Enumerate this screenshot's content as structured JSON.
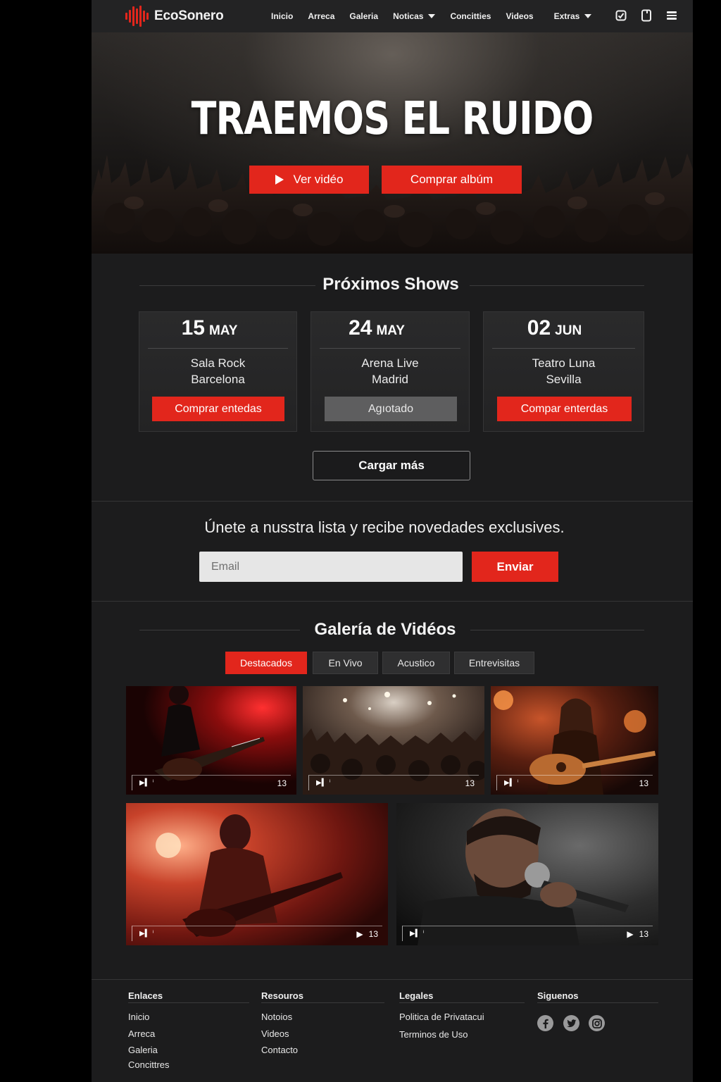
{
  "brand": {
    "name": "EcoSonero",
    "accent": "#e2261c"
  },
  "nav": {
    "items": [
      "Inicio",
      "Arreca",
      "Galeria",
      "Noticas",
      "Concitties",
      "Videos",
      "Extras"
    ],
    "dropdowns": [
      "Noticas",
      "Extras"
    ],
    "icons": [
      "checkbox-icon",
      "tablet-icon",
      "menu-icon"
    ]
  },
  "hero": {
    "title": "TRAEMOS EL RUIDO",
    "video_button": "Ver vidéo",
    "album_button": "Comprar albúm"
  },
  "shows": {
    "title": "Próximos Shows",
    "items": [
      {
        "day": "15",
        "month": "MAY",
        "venue": "Sala Rock",
        "city": "Barcelona",
        "button": "Comprar entedas",
        "status": "available"
      },
      {
        "day": "24",
        "month": "MAY",
        "venue": "Arena Live",
        "city": "Madrid",
        "button": "Agıotado",
        "status": "sold-out"
      },
      {
        "day": "02",
        "month": "JUN",
        "venue": "Teatro Luna",
        "city": "Sevilla",
        "button": "Compar enterdas",
        "status": "available"
      }
    ],
    "load_more": "Cargar más"
  },
  "newsletter": {
    "text": "Únete a nusstra lista y recibe novedades exclusives.",
    "placeholder": "Email",
    "button": "Enviar"
  },
  "gallery": {
    "title": "Galería de Vidéos",
    "tabs": [
      "Destacados",
      "En Vivo",
      "Acustico",
      "Entrevisitas"
    ],
    "active_tab": "Destacados",
    "videos": [
      {
        "subject": "guitarist-red-light",
        "count": "13"
      },
      {
        "subject": "concert-crowd",
        "count": "13"
      },
      {
        "subject": "acoustic-singer",
        "count": "13"
      },
      {
        "subject": "guitarist-fire",
        "count": "13"
      },
      {
        "subject": "singer-microphone",
        "count": "13"
      }
    ]
  },
  "footer": {
    "columns": [
      {
        "heading": "Enlaces",
        "links": [
          "Inicio",
          "Arreca",
          "Galeria",
          "Concittres"
        ]
      },
      {
        "heading": "Resouros",
        "links": [
          "Notoios",
          "Videos",
          "Contacto"
        ]
      },
      {
        "heading": "Legales",
        "links": [
          "Politica de Privatacui",
          "Terminos de Uso"
        ]
      },
      {
        "heading": "Siguenos",
        "social": [
          "facebook-icon",
          "twitter-icon",
          "instagram-icon"
        ]
      }
    ]
  }
}
